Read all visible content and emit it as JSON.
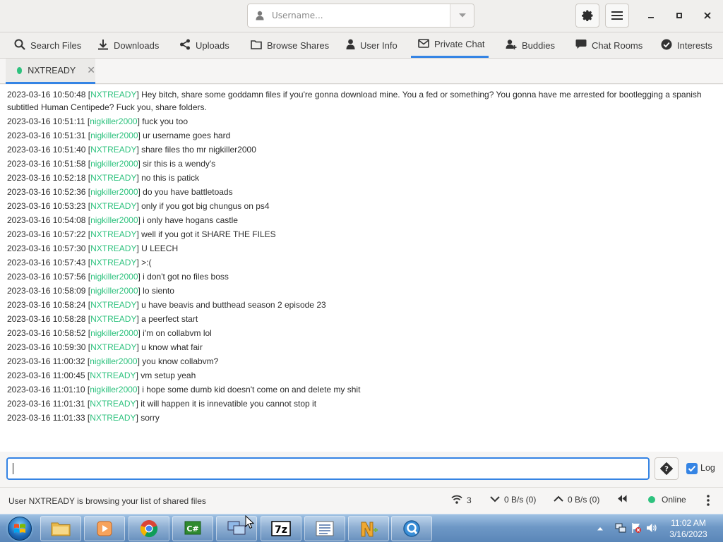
{
  "header": {
    "username_placeholder": "Username...",
    "icons": {
      "user": "user-icon",
      "dropdown": "chevron-down-icon",
      "settings": "gear-icon",
      "menu": "hamburger-menu-icon",
      "minimize": "minimize-icon",
      "maximize": "maximize-icon",
      "close": "close-icon"
    }
  },
  "tabs": [
    {
      "label": "Search Files",
      "icon": "search-icon"
    },
    {
      "label": "Downloads",
      "icon": "download-icon"
    },
    {
      "label": "Uploads",
      "icon": "share-icon"
    },
    {
      "label": "Browse Shares",
      "icon": "folder-icon"
    },
    {
      "label": "User Info",
      "icon": "user-icon"
    },
    {
      "label": "Private Chat",
      "icon": "envelope-icon",
      "active": true
    },
    {
      "label": "Buddies",
      "icon": "user-add-icon"
    },
    {
      "label": "Chat Rooms",
      "icon": "chat-bubble-icon"
    },
    {
      "label": "Interests",
      "icon": "checkmark-circle-icon"
    }
  ],
  "chat_tab": {
    "label": "NXTREADY",
    "status_color": "#2ec27e"
  },
  "messages": [
    {
      "time": "2023-03-16 10:50:48",
      "user": "NXTREADY",
      "text": "Hey bitch, share some goddamn files if you're gonna download mine. You a fed or something? You gonna have me arrested for bootlegging a spanish subtitled Human Centipede? Fuck you, share folders."
    },
    {
      "time": "2023-03-16 10:51:11",
      "user": "nigkiller2000",
      "text": "fuck you too"
    },
    {
      "time": "2023-03-16 10:51:31",
      "user": "nigkiller2000",
      "text": "ur username goes hard"
    },
    {
      "time": "2023-03-16 10:51:40",
      "user": "NXTREADY",
      "text": "share files tho mr nigkiller2000"
    },
    {
      "time": "2023-03-16 10:51:58",
      "user": "nigkiller2000",
      "text": "sir this is a wendy's"
    },
    {
      "time": "2023-03-16 10:52:18",
      "user": "NXTREADY",
      "text": "no this is patick"
    },
    {
      "time": "2023-03-16 10:52:36",
      "user": "nigkiller2000",
      "text": "do you have battletoads"
    },
    {
      "time": "2023-03-16 10:53:23",
      "user": "NXTREADY",
      "text": "only if you got big chungus on ps4"
    },
    {
      "time": "2023-03-16 10:54:08",
      "user": "nigkiller2000",
      "text": "i only have hogans castle"
    },
    {
      "time": "2023-03-16 10:57:22",
      "user": "NXTREADY",
      "text": "well if you got it SHARE THE FILES"
    },
    {
      "time": "2023-03-16 10:57:30",
      "user": "NXTREADY",
      "text": "U LEECH"
    },
    {
      "time": "2023-03-16 10:57:43",
      "user": "NXTREADY",
      "text": ">:("
    },
    {
      "time": "2023-03-16 10:57:56",
      "user": "nigkiller2000",
      "text": "i don't got no files boss"
    },
    {
      "time": "2023-03-16 10:58:09",
      "user": "nigkiller2000",
      "text": "lo siento"
    },
    {
      "time": "2023-03-16 10:58:24",
      "user": "NXTREADY",
      "text": "u have beavis and butthead season 2 episode 23"
    },
    {
      "time": "2023-03-16 10:58:28",
      "user": "NXTREADY",
      "text": "a peerfect start"
    },
    {
      "time": "2023-03-16 10:58:52",
      "user": "nigkiller2000",
      "text": "i'm on collabvm lol"
    },
    {
      "time": "2023-03-16 10:59:30",
      "user": "NXTREADY",
      "text": "u know what fair"
    },
    {
      "time": "2023-03-16 11:00:32",
      "user": "nigkiller2000",
      "text": "you know collabvm?"
    },
    {
      "time": "2023-03-16 11:00:45",
      "user": "NXTREADY",
      "text": "vm setup yeah"
    },
    {
      "time": "2023-03-16 11:01:10",
      "user": "nigkiller2000",
      "text": "i hope some dumb kid doesn't come on and delete my shit"
    },
    {
      "time": "2023-03-16 11:01:31",
      "user": "NXTREADY",
      "text": "it will happen it is innevatible you cannot stop it"
    },
    {
      "time": "2023-03-16 11:01:33",
      "user": "NXTREADY",
      "text": "sorry"
    }
  ],
  "entry": {
    "value": "",
    "emoji_icon": "emoji-help-icon",
    "log_label": "Log",
    "log_checked": true
  },
  "statusbar": {
    "message": "User NXTREADY is browsing your list of shared files",
    "connections": "3",
    "download_speed": "0 B/s (0)",
    "upload_speed": "0 B/s (0)",
    "status": "Online",
    "status_color": "#2ec27e"
  },
  "taskbar": {
    "apps": [
      "file-explorer-icon",
      "media-player-icon",
      "chrome-icon",
      "csharp-project-icon",
      "network-settings-icon",
      "7zip-icon",
      "notepad-list-icon",
      "notepad-plus-icon",
      "quicktime-icon"
    ],
    "clock_time": "11:02 AM",
    "clock_date": "3/16/2023"
  },
  "colors": {
    "accent": "#3584e4",
    "nick": "#2ec27e"
  }
}
